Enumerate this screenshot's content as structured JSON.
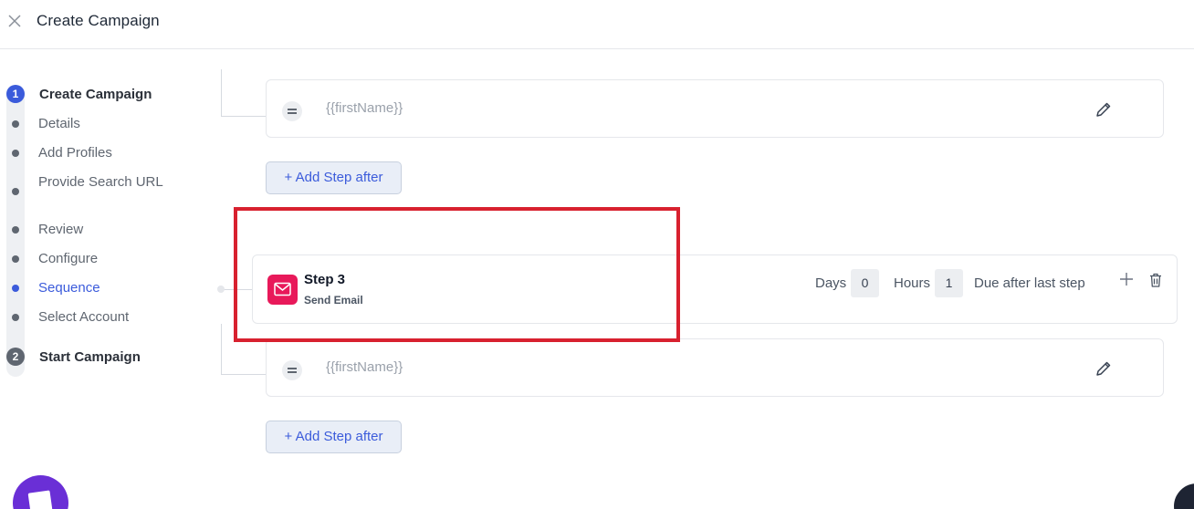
{
  "header": {
    "title": "Create Campaign"
  },
  "stepper": {
    "steps": [
      {
        "number": "1",
        "title": "Create Campaign",
        "substeps": [
          "Details",
          "Add Profiles",
          "Provide Search URL",
          "Review",
          "Configure",
          "Sequence",
          "Select Account"
        ],
        "current_substep": "Sequence"
      },
      {
        "number": "2",
        "title": "Start Campaign"
      }
    ]
  },
  "sequence": {
    "templates": [
      {
        "text": "{{firstName}}"
      },
      {
        "text": "{{firstName}}"
      }
    ],
    "add_step_label": "+ Add Step after",
    "step": {
      "title": "Step 3",
      "action": "Send Email",
      "days_label": "Days",
      "days_value": "0",
      "hours_label": "Hours",
      "hours_value": "1",
      "due_label": "Due after last step"
    }
  },
  "colors": {
    "accent": "#3b5bdb",
    "email_badge": "#e8195a",
    "highlight": "#d8212f",
    "chat_widget": "#6a2fd6"
  }
}
